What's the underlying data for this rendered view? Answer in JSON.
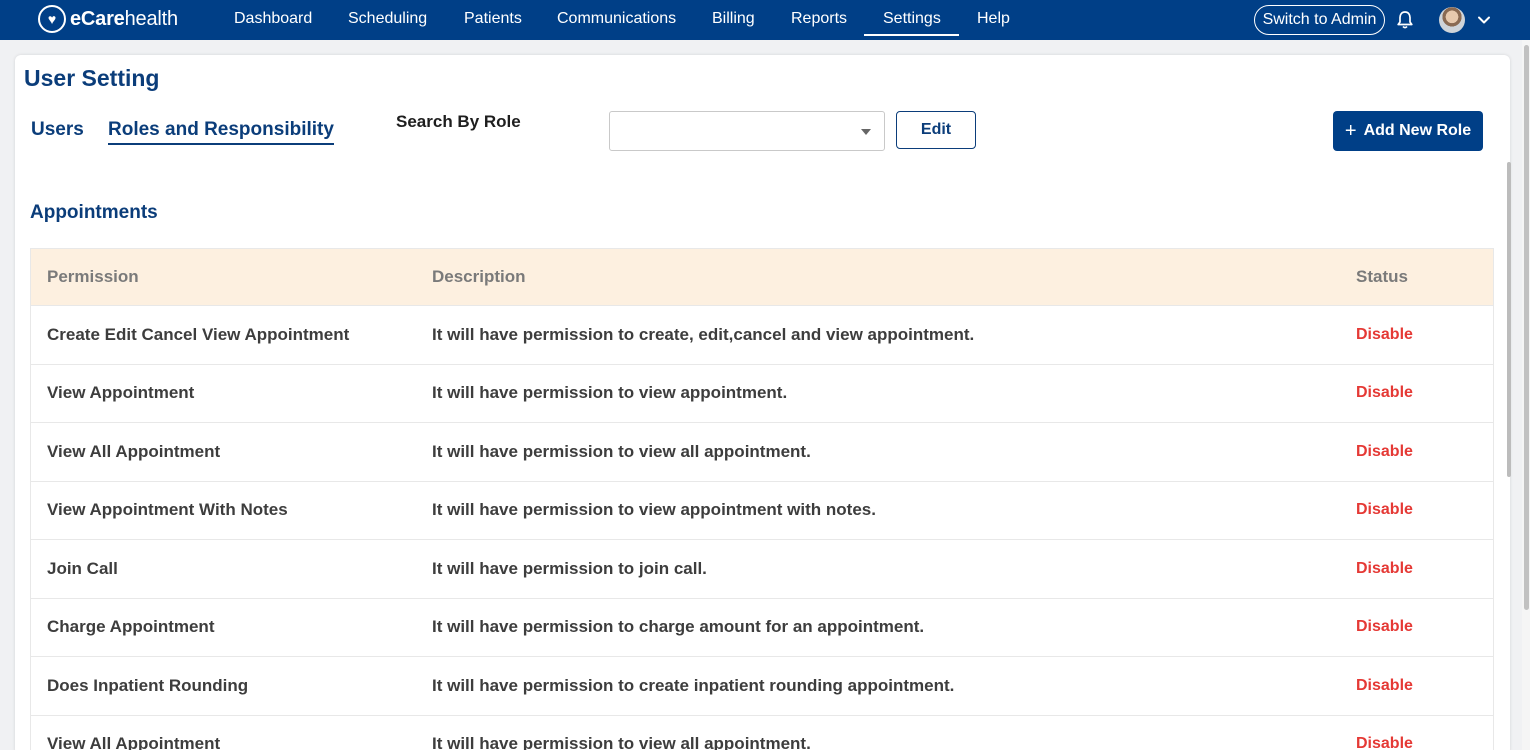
{
  "brand": {
    "logo_glyph": "♥",
    "name_bold": "eCare",
    "name_light": "health"
  },
  "nav": {
    "items": [
      {
        "label": "Dashboard",
        "active": false
      },
      {
        "label": "Scheduling",
        "active": false
      },
      {
        "label": "Patients",
        "active": false
      },
      {
        "label": "Communications",
        "active": false
      },
      {
        "label": "Billing",
        "active": false
      },
      {
        "label": "Reports",
        "active": false
      },
      {
        "label": "Settings",
        "active": true
      },
      {
        "label": "Help",
        "active": false
      }
    ],
    "switch_label": "Switch to Admin",
    "bell_icon": "bell-icon",
    "avatar_icon": "user-avatar",
    "chevron_icon": "chevron-down-icon"
  },
  "page": {
    "title": "User Setting",
    "tabs": [
      {
        "label": "Users",
        "active": false
      },
      {
        "label": "Roles and Responsibility",
        "active": true
      }
    ],
    "search_label": "Search By Role",
    "role_select_value": "",
    "edit_label": "Edit",
    "add_label": "Add New Role",
    "add_icon": "plus-icon"
  },
  "section": {
    "title": "Appointments",
    "columns": [
      "Permission",
      "Description",
      "Status"
    ],
    "rows": [
      {
        "permission": "Create Edit Cancel View Appointment",
        "description": "It will have permission to create, edit,cancel and view appointment.",
        "status": "Disable"
      },
      {
        "permission": "View Appointment",
        "description": "It will have permission to view appointment.",
        "status": "Disable"
      },
      {
        "permission": "View All Appointment",
        "description": "It will have permission to view all appointment.",
        "status": "Disable"
      },
      {
        "permission": "View Appointment With Notes",
        "description": "It will have permission to view appointment with notes.",
        "status": "Disable"
      },
      {
        "permission": "Join Call",
        "description": "It will have permission to join call.",
        "status": "Disable"
      },
      {
        "permission": "Charge Appointment",
        "description": "It will have permission to charge amount for an appointment.",
        "status": "Disable"
      },
      {
        "permission": "Does Inpatient Rounding",
        "description": "It will have permission to create inpatient rounding appointment.",
        "status": "Disable"
      },
      {
        "permission": "View All Appointment",
        "description": "It will have permission to view all appointment.",
        "status": "Disable"
      }
    ]
  },
  "colors": {
    "nav_bg": "#003f87",
    "accent": "#0b3d7a",
    "header_row_bg": "#fdf0e0",
    "status_disable": "#e53935"
  }
}
